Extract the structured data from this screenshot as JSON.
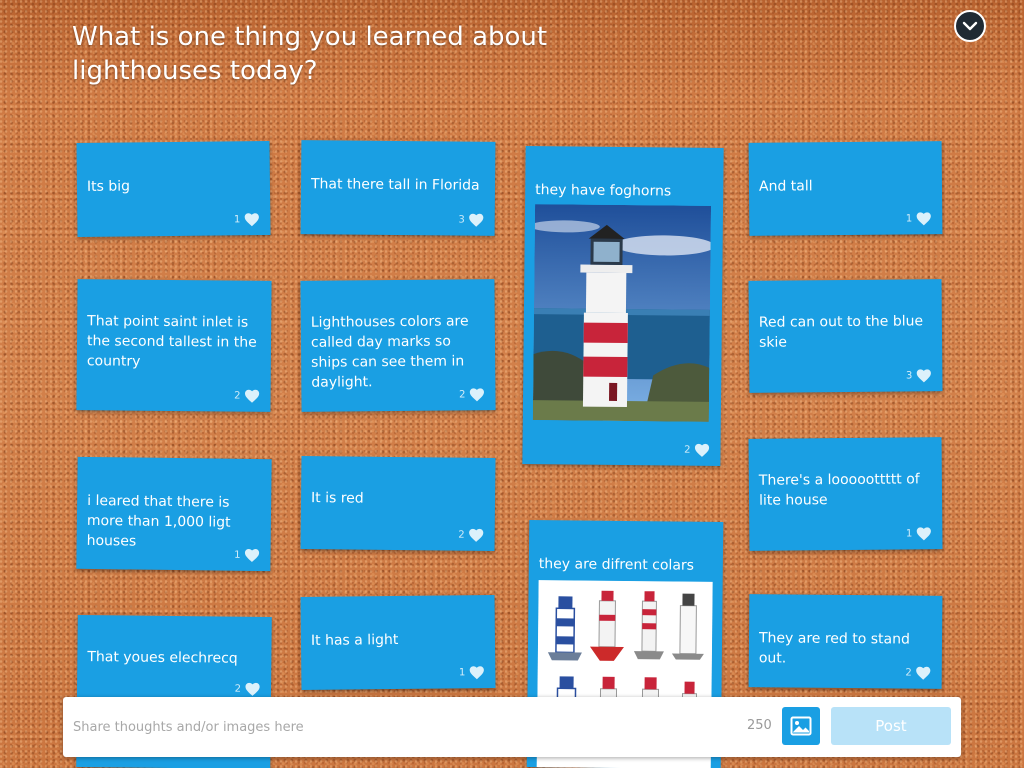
{
  "prompt": {
    "title": "What is one thing you learned about lighthouses today?"
  },
  "header": {
    "collapse_icon": "chevron-down-circle-icon"
  },
  "cards": [
    {
      "text": "Its big",
      "likes": "1"
    },
    {
      "text": "That there tall in Florida",
      "likes": "3"
    },
    {
      "text": "they have foghorns",
      "likes": "2",
      "image": "lighthouse-photo"
    },
    {
      "text": "And tall",
      "likes": "1"
    },
    {
      "text": "That point saint inlet is the second tallest in the country",
      "likes": "2"
    },
    {
      "text": "Lighthouses colors are called day marks so ships can see them in daylight.",
      "likes": "2"
    },
    {
      "text": "Red can out to the blue skie",
      "likes": "3"
    },
    {
      "text": "i leared that there is more than 1,000 ligt houses",
      "likes": "1"
    },
    {
      "text": "It is red",
      "likes": "2"
    },
    {
      "text": "There's a looooottttt of lite house",
      "likes": "1"
    },
    {
      "text": "they are difrent colars",
      "likes": "",
      "image": "lighthouse-illustrations"
    },
    {
      "text": "That youes elechrecq",
      "likes": "2"
    },
    {
      "text": "It has a light",
      "likes": "1"
    },
    {
      "text": "They are red to stand out.",
      "likes": "2"
    }
  ],
  "composer": {
    "placeholder": "Share thoughts and/or images here",
    "char_count": "250",
    "image_icon": "image-icon",
    "post_label": "Post"
  },
  "colors": {
    "card_blue": "#1a9fe3",
    "board_cork": "#c9713f",
    "post_disabled": "#b8e2f8"
  }
}
